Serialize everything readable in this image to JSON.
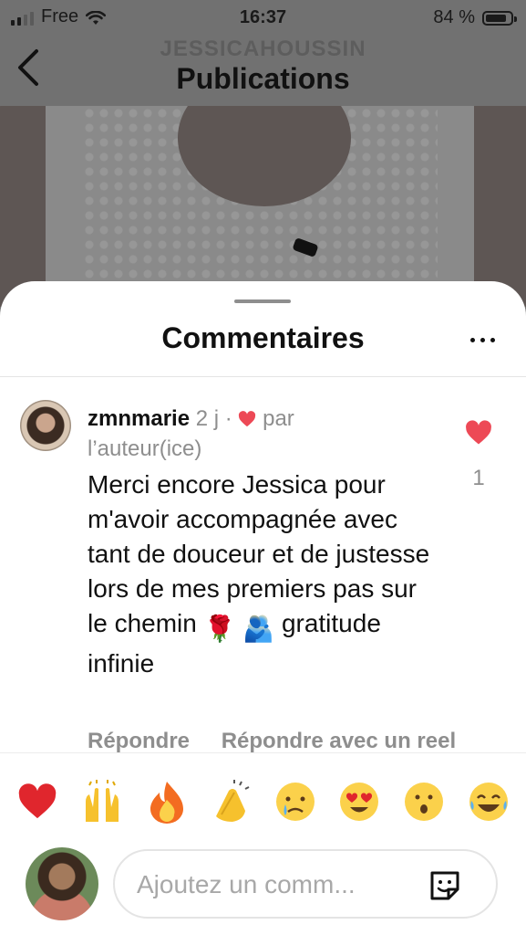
{
  "status_bar": {
    "carrier": "Free",
    "time": "16:37",
    "battery": "84 %",
    "battery_level": 0.84
  },
  "nav": {
    "subtitle": "JESSICAHOUSSIN",
    "title": "Publications",
    "back_icon": "chevron-left-icon"
  },
  "sheet": {
    "title": "Commentaires",
    "more_icon": "ellipsis-icon"
  },
  "comment": {
    "username": "zmnmarie",
    "age": "2 j",
    "separator": "·",
    "liked_by_line1": "par",
    "liked_by_line2": "l’auteur(ice)",
    "text_part1": "Merci encore Jessica pour m'avoir accompagnée avec tant de douceur et de justesse lors de mes premiers pas sur le chemin",
    "emoji1": "🌹",
    "emoji2": "🫂",
    "text_part2": "gratitude infinie",
    "reply_label": "Répondre",
    "reply_reel_label": "Répondre avec un reel",
    "like_count": "1",
    "accent_color": "#ed4956"
  },
  "reactions": [
    "❤️",
    "🙌",
    "🔥",
    "👏",
    "😢",
    "😍",
    "😮",
    "😂"
  ],
  "composer": {
    "placeholder": "Ajoutez un comm...",
    "sticker_icon": "sticker-icon"
  }
}
